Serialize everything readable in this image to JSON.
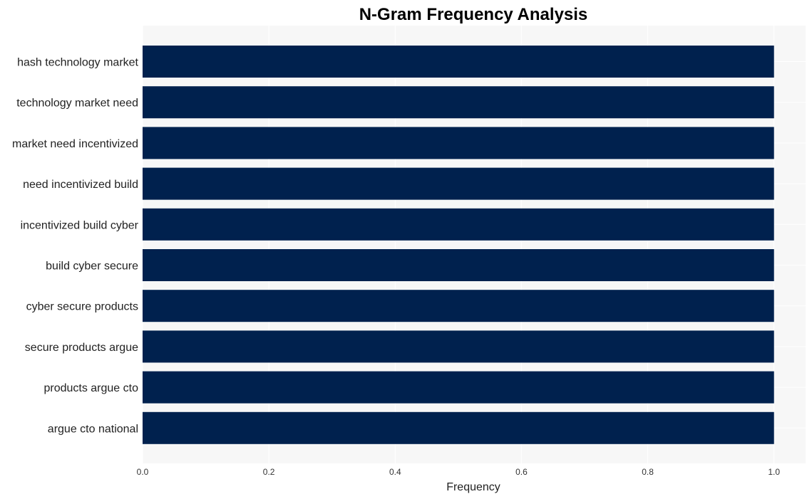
{
  "chart_data": {
    "type": "bar",
    "orientation": "horizontal",
    "title": "N-Gram Frequency Analysis",
    "xlabel": "Frequency",
    "ylabel": "",
    "categories": [
      "hash technology market",
      "technology market need",
      "market need incentivized",
      "need incentivized build",
      "incentivized build cyber",
      "build cyber secure",
      "cyber secure products",
      "secure products argue",
      "products argue cto",
      "argue cto national"
    ],
    "values": [
      1,
      1,
      1,
      1,
      1,
      1,
      1,
      1,
      1,
      1
    ],
    "xlim": [
      0,
      1.05
    ],
    "xticks": [
      0.0,
      0.2,
      0.4,
      0.6,
      0.8,
      1.0
    ],
    "xtick_labels": [
      "0.0",
      "0.2",
      "0.4",
      "0.6",
      "0.8",
      "1.0"
    ],
    "grid": true,
    "legend": "none",
    "colors": {
      "bar": "#00214e",
      "plot_background": "#f7f7f7",
      "grid": "#ffffff"
    }
  }
}
